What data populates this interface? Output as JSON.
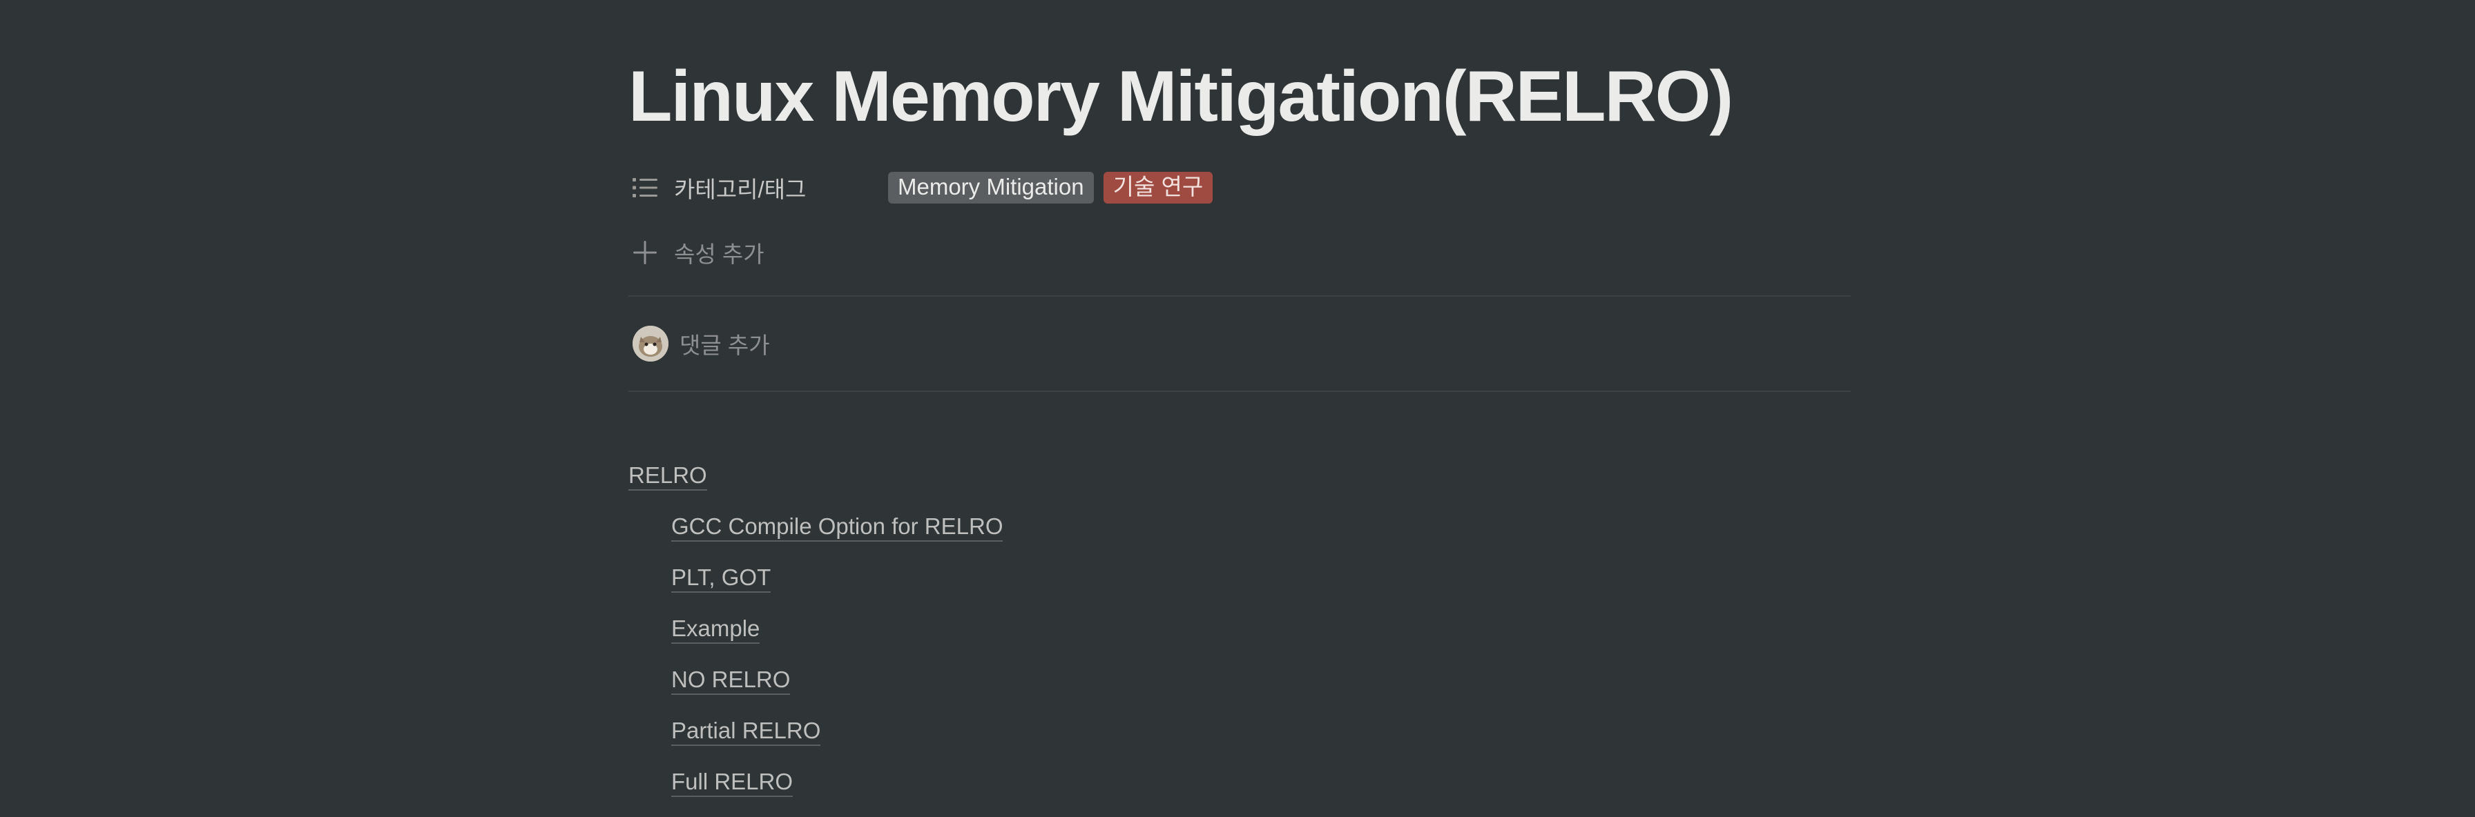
{
  "page": {
    "title": "Linux Memory Mitigation(RELRO)"
  },
  "properties": {
    "tags": {
      "icon": "list-icon",
      "label": "카테고리/태그",
      "values": [
        {
          "label": "Memory Mitigation",
          "color": "#5a5e60"
        },
        {
          "label": "기술 연구",
          "color": "#a04b42"
        }
      ]
    },
    "add_property": {
      "icon": "plus-icon",
      "label": "속성 추가"
    }
  },
  "comments": {
    "placeholder": "댓글 추가"
  },
  "toc": {
    "items": [
      {
        "label": "RELRO",
        "level": 1
      },
      {
        "label": "GCC Compile Option for RELRO",
        "level": 2
      },
      {
        "label": "PLT, GOT",
        "level": 2
      },
      {
        "label": "Example",
        "level": 2
      },
      {
        "label": "NO RELRO",
        "level": 2
      },
      {
        "label": "Partial RELRO",
        "level": 2
      },
      {
        "label": "Full RELRO",
        "level": 2
      }
    ]
  },
  "theme": {
    "background": "#2f3437",
    "text": "#ebebea"
  }
}
